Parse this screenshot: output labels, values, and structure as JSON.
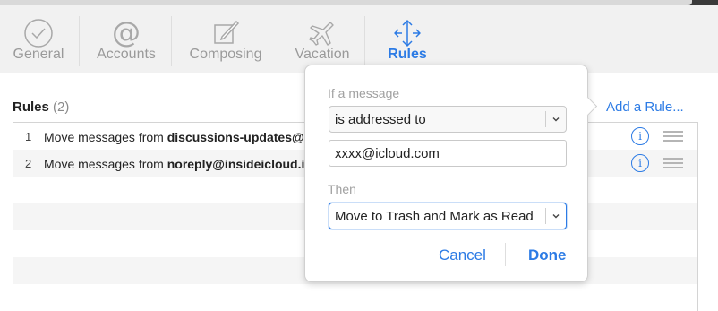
{
  "toolbar": {
    "tabs": [
      {
        "label": "General",
        "icon": "checkmark-circle-icon"
      },
      {
        "label": "Accounts",
        "icon": "at-sign-icon"
      },
      {
        "label": "Composing",
        "icon": "compose-icon"
      },
      {
        "label": "Vacation",
        "icon": "airplane-icon"
      },
      {
        "label": "Rules",
        "icon": "arrows-icon",
        "active": true
      }
    ],
    "accent_color": "#2c7be5"
  },
  "rules": {
    "title": "Rules",
    "count": "(2)",
    "add_rule_label": "Add a Rule...",
    "items": [
      {
        "num": "1",
        "prefix": "Move messages from ",
        "sender": "discussions-updates@ap"
      },
      {
        "num": "2",
        "prefix": "Move messages from ",
        "sender": "noreply@insideicloud.iclo"
      }
    ]
  },
  "popover": {
    "if_label": "If a message",
    "condition_value": "is addressed to",
    "email_value": "xxxx@icloud.com",
    "then_label": "Then",
    "action_value": "Move to Trash and Mark as Read",
    "cancel_label": "Cancel",
    "done_label": "Done"
  }
}
